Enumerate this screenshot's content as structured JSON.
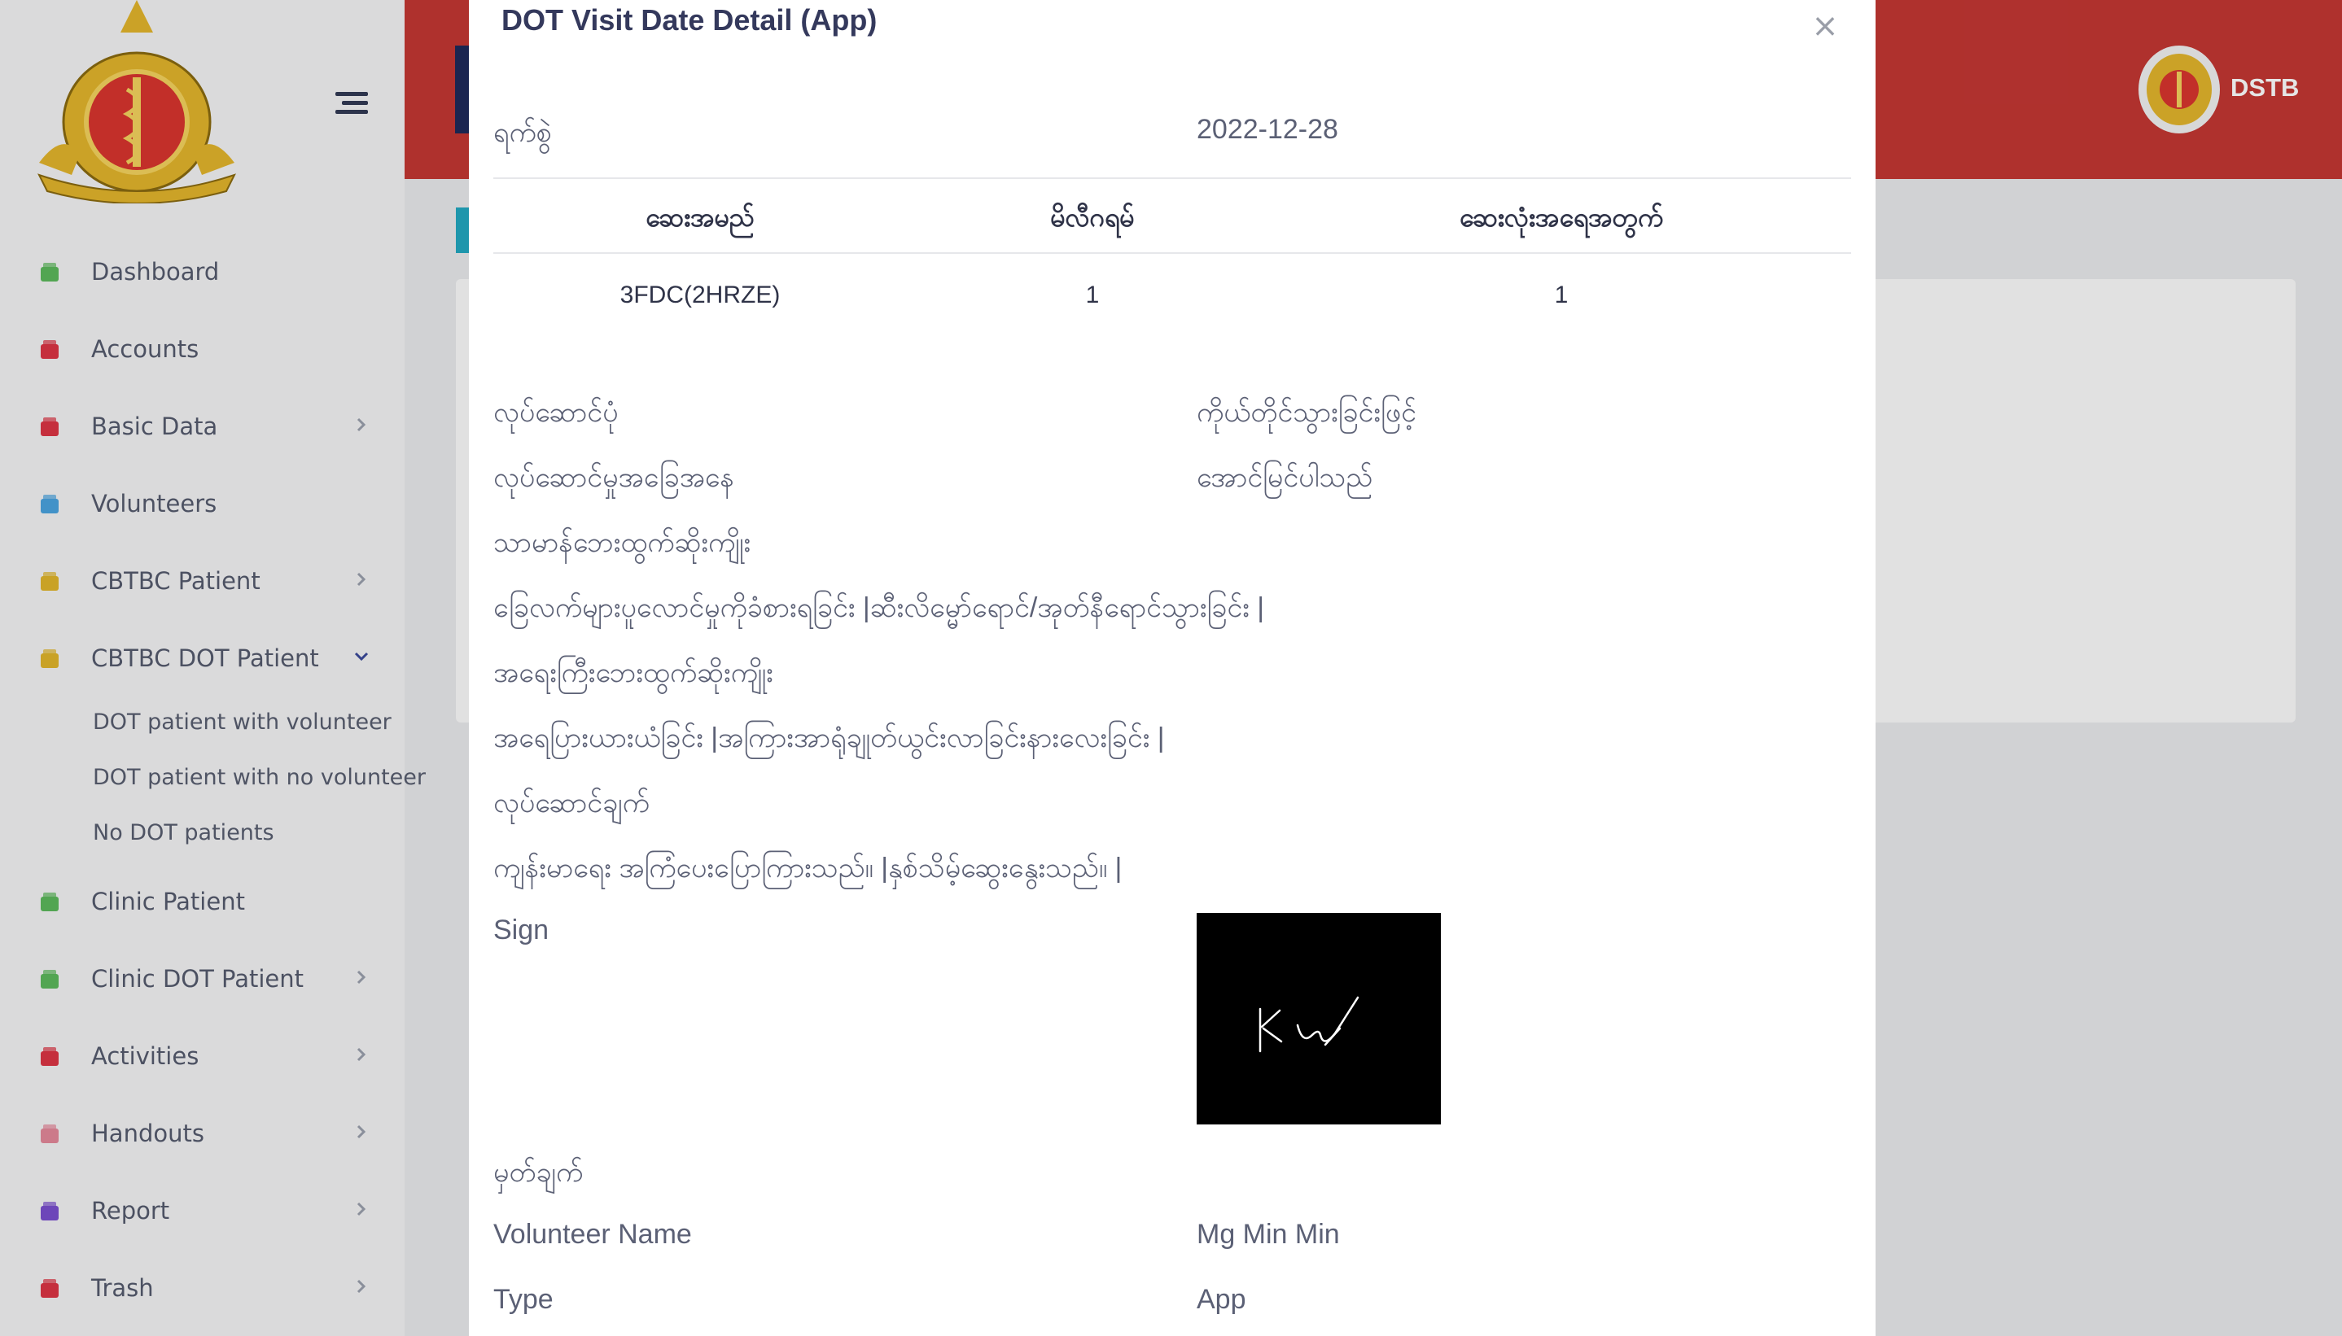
{
  "app": {
    "user": "DSTB"
  },
  "sidebar": {
    "items": [
      {
        "label": "Dashboard",
        "color": "#5cb85c"
      },
      {
        "label": "Accounts",
        "color": "#dc3545"
      },
      {
        "label": "Basic Data",
        "color": "#dc3545"
      },
      {
        "label": "Volunteers",
        "color": "#4aa3df"
      },
      {
        "label": "CBTBC Patient",
        "color": "#e0b52b"
      },
      {
        "label": "CBTBC DOT Patient",
        "color": "#e0b52b"
      },
      {
        "label": "Clinic Patient",
        "color": "#5cb85c"
      },
      {
        "label": "Clinic DOT Patient",
        "color": "#5cb85c"
      },
      {
        "label": "Activities",
        "color": "#dc3545"
      },
      {
        "label": "Handouts",
        "color": "#e4889a"
      },
      {
        "label": "Report",
        "color": "#7a4fcf"
      },
      {
        "label": "Trash",
        "color": "#dc3545"
      }
    ],
    "subitems": [
      "DOT patient with volunteer",
      "DOT patient with no volunteer",
      "No DOT patients"
    ]
  },
  "modal": {
    "title": "DOT Visit Date Detail (App)",
    "close": "×",
    "date_label": "ရက်စွဲ",
    "date_value": "2022-12-28",
    "table": {
      "headers": [
        "ဆေးအမည်",
        "မိလီဂရမ်",
        "ဆေးလုံးအရေအတွက်"
      ],
      "rows": [
        [
          "3FDC(2HRZE)",
          "1",
          "1"
        ]
      ]
    },
    "fields": {
      "method_label": "လုပ်ဆောင်ပုံ",
      "method_value": "ကိုယ်တိုင်သွားခြင်းဖြင့်",
      "status_label": "လုပ်ဆောင်မှုအခြေအနေ",
      "status_value": "အောင်မြင်ပါသည်",
      "minor_se_label": "သာမာန်ဘေးထွက်ဆိုးကျိုး",
      "minor_se_value": "ခြေလက်များပူလောင်မှုကိုခံစားရခြင်း |ဆီးလိမ္မော်ရောင်/အုတ်နီရောင်သွားခြင်း |",
      "major_se_label": "အရေးကြီးဘေးထွက်ဆိုးကျိုး",
      "major_se_value": "အရေပြားယားယံခြင်း |အကြားအာရုံချုတ်ယွင်းလာခြင်းနားလေးခြင်း |",
      "action_label": "လုပ်ဆောင်ချက်",
      "action_value": "ကျန်းမာရေး အကြံပေးပြောကြားသည်။ |နှစ်သိမ့်ဆွေးနွေးသည်။ |",
      "sign_label": "Sign",
      "remark_label": "မှတ်ချက်",
      "volunteer_label": "Volunteer Name",
      "volunteer_value": "Mg Min Min",
      "type_label": "Type",
      "type_value": "App"
    }
  }
}
